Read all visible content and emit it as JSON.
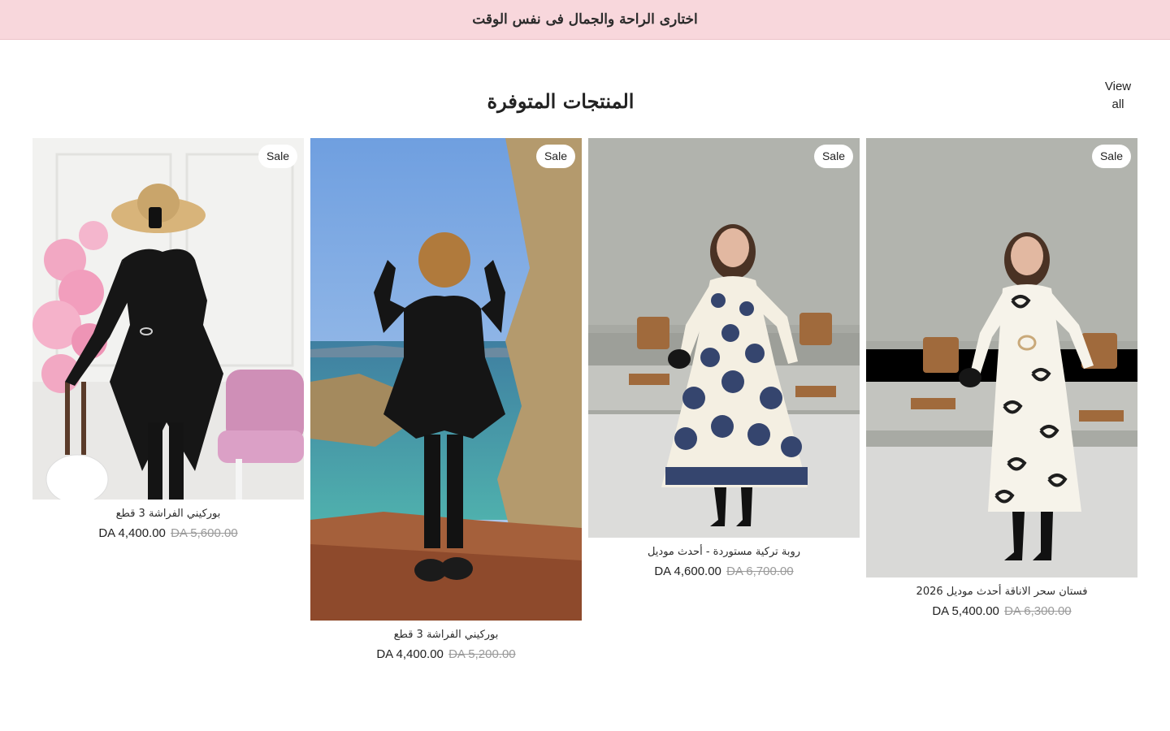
{
  "announcement": {
    "text": "اختارى الراحة والجمال فى نفس الوقت"
  },
  "section": {
    "title": "المنتجات المتوفرة",
    "view_all_line1": "View",
    "view_all_line2": "all"
  },
  "products": [
    {
      "title": "بوركيني الفراشة 3 قطع",
      "price": "DA 4,400.00",
      "compare_price": "DA 5,600.00",
      "badge": "Sale"
    },
    {
      "title": "بوركيني الفراشة 3 قطع",
      "price": "DA 4,400.00",
      "compare_price": "DA 5,200.00",
      "badge": "Sale"
    },
    {
      "title": "روبة تركية مستوردة - أحدث موديل",
      "price": "DA 4,600.00",
      "compare_price": "DA 6,700.00",
      "badge": "Sale"
    },
    {
      "title": "فستان سحر الاناقة أحدث موديل 2026",
      "price": "DA 5,400.00",
      "compare_price": "DA 6,300.00",
      "badge": "Sale"
    }
  ],
  "colors": {
    "announcement_bg": "#f8d7dc",
    "text": "#222222",
    "muted": "#9a9a9a"
  }
}
